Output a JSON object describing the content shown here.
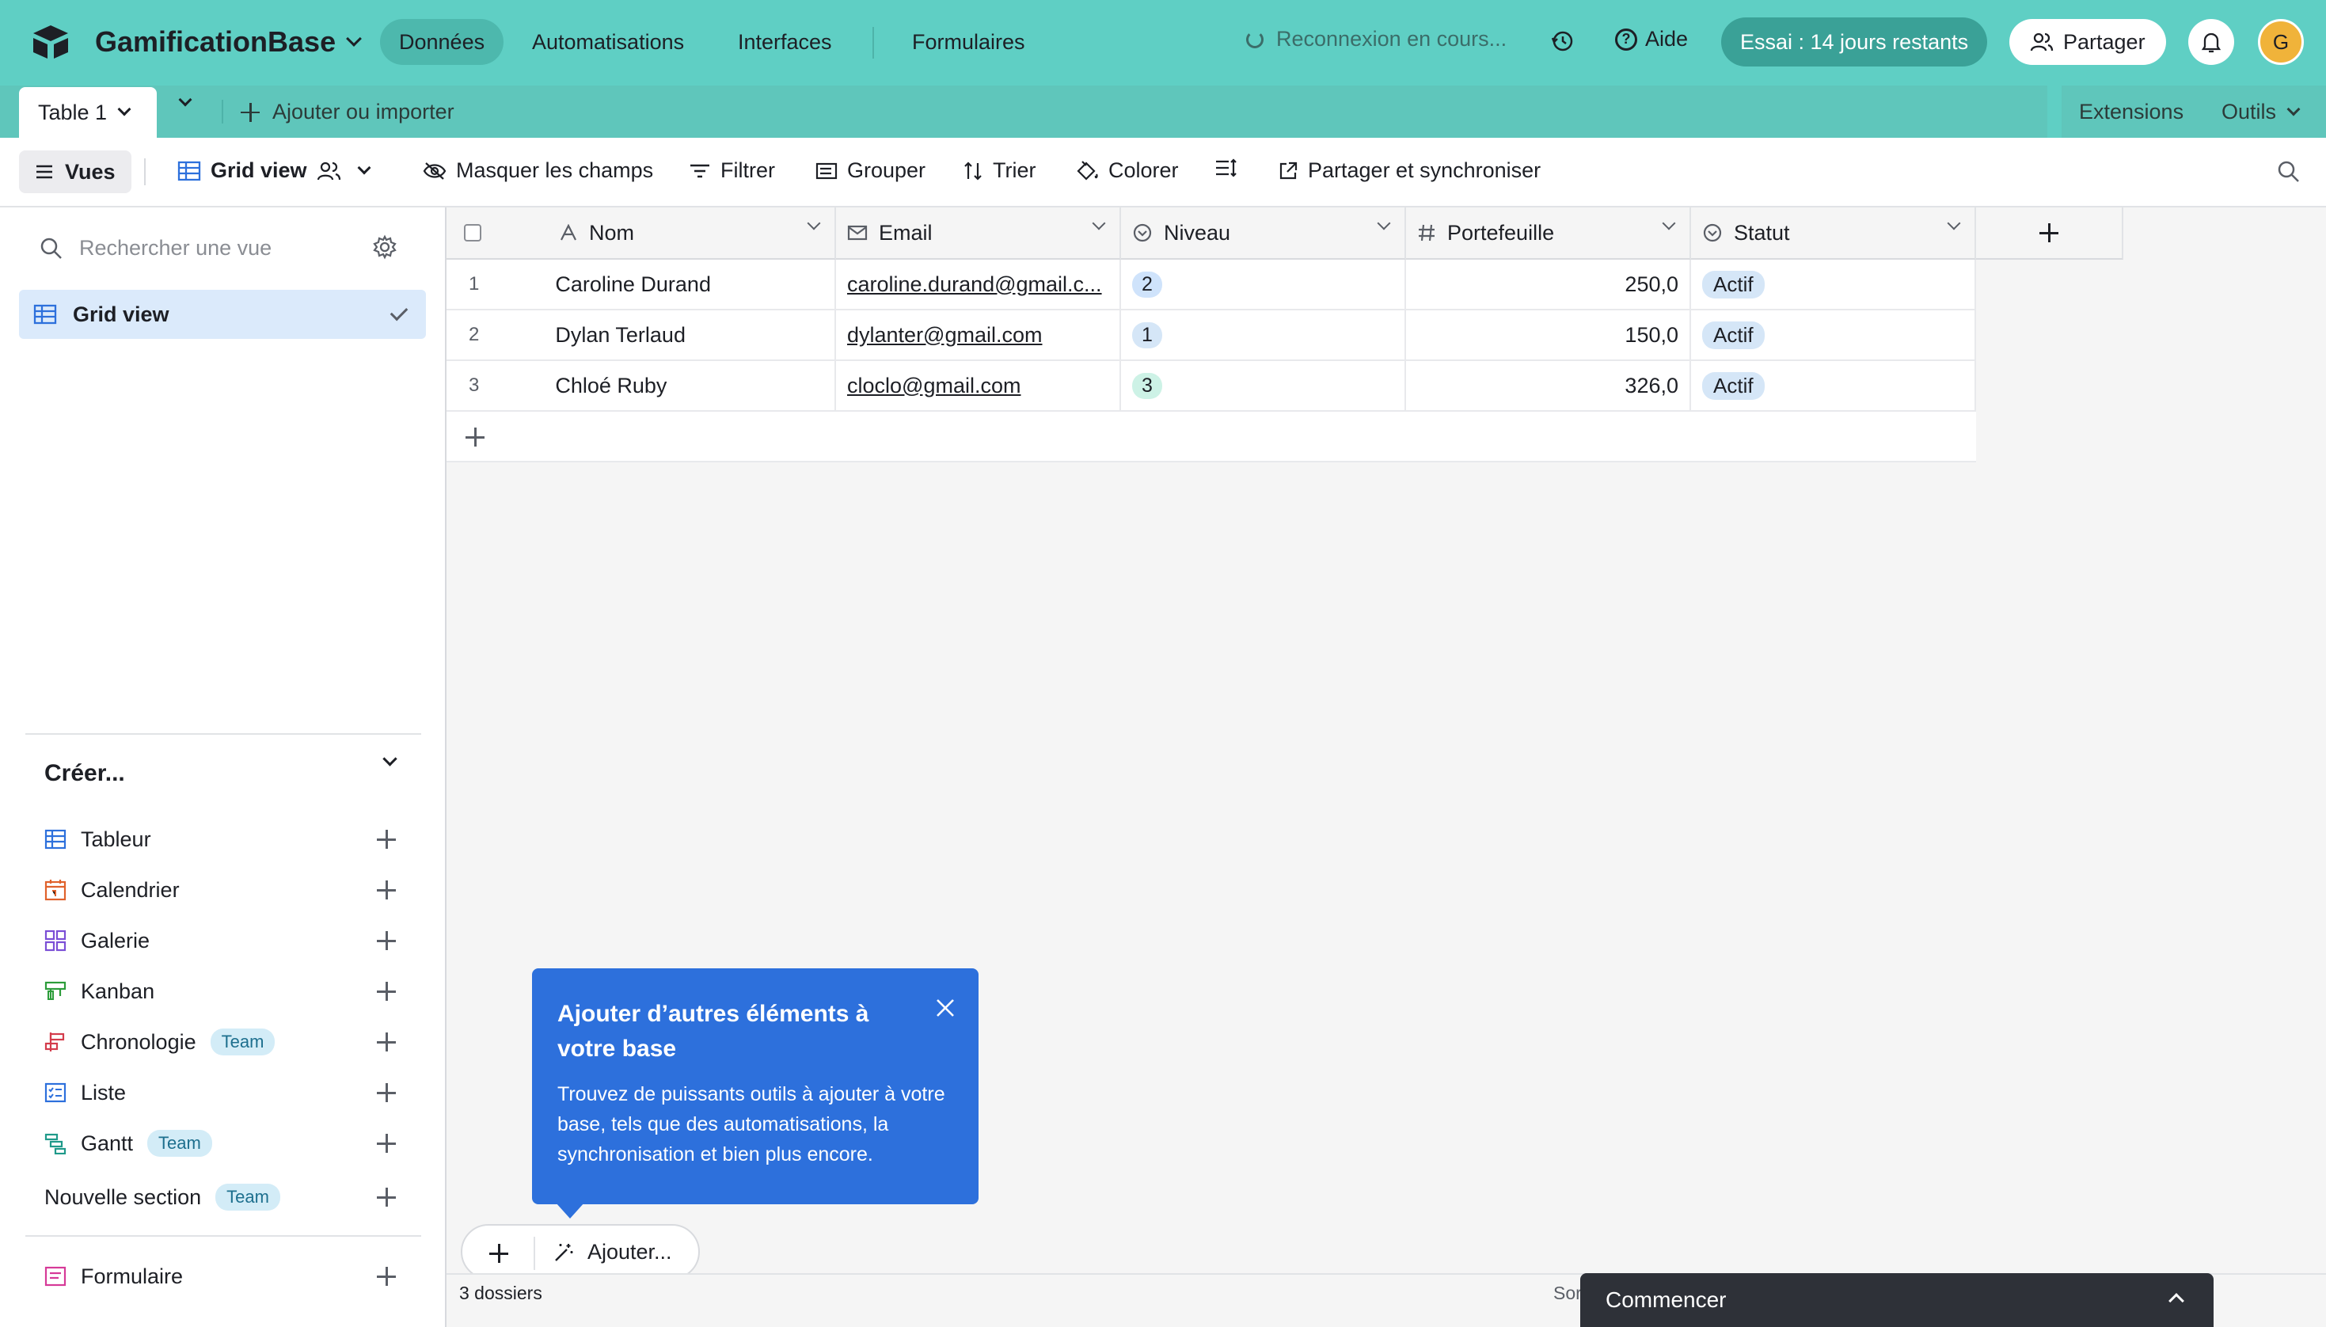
{
  "topbar": {
    "base_name": "GamificationBase",
    "nav": [
      "Données",
      "Automatisations",
      "Interfaces",
      "Formulaires"
    ],
    "reconnect": "Reconnexion en cours...",
    "help": "Aide",
    "trial": "Essai : 14 jours restants",
    "share": "Partager",
    "avatar_letter": "G",
    "bg_color": "#5fcfc4"
  },
  "tabs": {
    "table": "Table 1",
    "add_import": "Ajouter ou importer",
    "extensions": "Extensions",
    "tools": "Outils"
  },
  "toolbar": {
    "views": "Vues",
    "grid_view": "Grid view",
    "hide_fields": "Masquer les champs",
    "filter": "Filtrer",
    "group": "Grouper",
    "sort": "Trier",
    "color": "Colorer",
    "share_sync": "Partager et synchroniser"
  },
  "sidebar": {
    "search_placeholder": "Rechercher une vue",
    "active_view": "Grid view",
    "create_title": "Créer...",
    "create_items": [
      {
        "label": "Tableur",
        "icon": "grid-icon",
        "color": "#2d70dc",
        "badge": ""
      },
      {
        "label": "Calendrier",
        "icon": "calendar-icon",
        "color": "#e0622c",
        "badge": ""
      },
      {
        "label": "Galerie",
        "icon": "gallery-icon",
        "color": "#7b4fd6",
        "badge": ""
      },
      {
        "label": "Kanban",
        "icon": "kanban-icon",
        "color": "#2c9c3a",
        "badge": ""
      },
      {
        "label": "Chronologie",
        "icon": "timeline-icon",
        "color": "#d43c4c",
        "badge": "Team"
      },
      {
        "label": "Liste",
        "icon": "list-icon",
        "color": "#2d70dc",
        "badge": ""
      },
      {
        "label": "Gantt",
        "icon": "gantt-icon",
        "color": "#1f9a8a",
        "badge": "Team"
      }
    ],
    "new_section": "Nouvelle section",
    "new_section_badge": "Team",
    "form": "Formulaire"
  },
  "grid": {
    "columns": [
      "Nom",
      "Email",
      "Niveau",
      "Portefeuille",
      "Statut"
    ],
    "rows": [
      {
        "num": "1",
        "nom": "Caroline Durand",
        "email": "caroline.durand@gmail.c...",
        "niveau": "2",
        "niveau_color": "#cfe3fb",
        "portefeuille": "250,0",
        "statut": "Actif"
      },
      {
        "num": "2",
        "nom": "Dylan Terlaud",
        "email": "dylanter@gmail.com",
        "niveau": "1",
        "niveau_color": "#d5e6f7",
        "portefeuille": "150,0",
        "statut": "Actif"
      },
      {
        "num": "3",
        "nom": "Chloé Ruby",
        "email": "cloclo@gmail.com",
        "niveau": "3",
        "niveau_color": "#cdf2e6",
        "portefeuille": "326,0",
        "statut": "Actif"
      }
    ]
  },
  "popover": {
    "title": "Ajouter d’autres éléments à votre base",
    "body": "Trouvez de puissants outils à ajouter à votre base, tels que des automatisations, la synchronisation et bien plus encore."
  },
  "footer": {
    "add": "Ajouter...",
    "records": "3 dossiers",
    "sum": "Sor",
    "start": "Commencer"
  }
}
